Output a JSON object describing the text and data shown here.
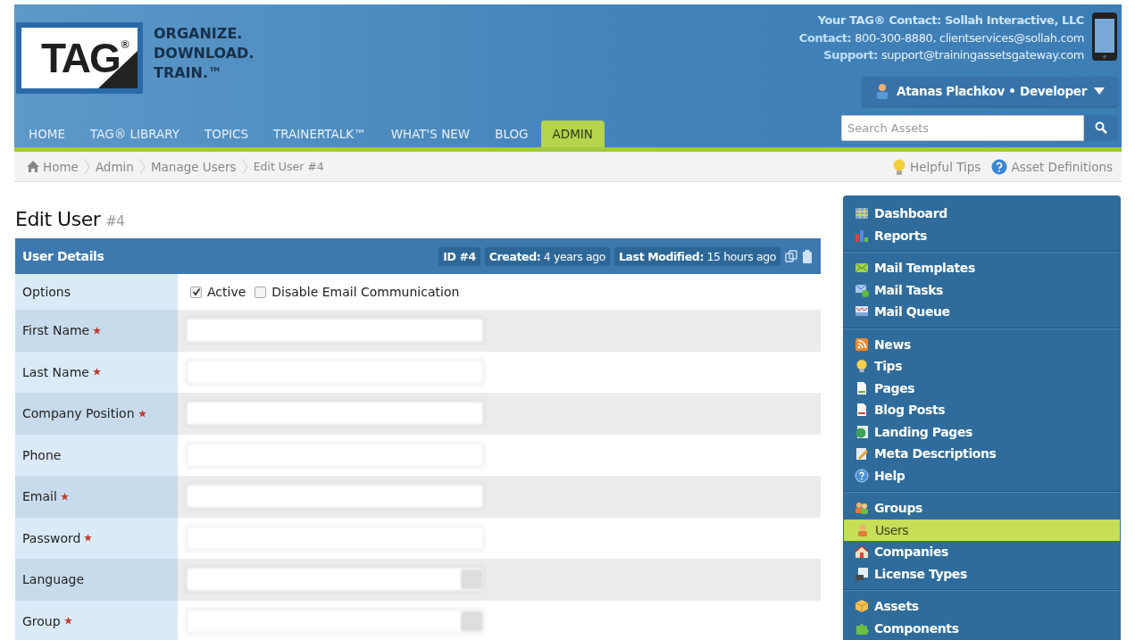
{
  "header": {
    "logo": "TAG",
    "logo_mark": "®",
    "tagline": [
      "ORGANIZE.",
      "DOWNLOAD.",
      "TRAIN.™"
    ],
    "contact_lines": [
      "Your TAG® Contact: Sollah Interactive, LLC",
      "**Contact:** 800-300-8880, clientservices@sollah.com",
      "**Support:** support@trainingassetsgateway.com"
    ],
    "user_menu": {
      "label": "Atanas Plachkov • Developer"
    },
    "search": {
      "placeholder": "Search Assets"
    }
  },
  "nav": [
    {
      "label": "HOME",
      "selected": false
    },
    {
      "label": "TAG® LIBRARY",
      "selected": false
    },
    {
      "label": "TOPICS",
      "selected": false
    },
    {
      "label": "TRAINERTALK™",
      "selected": false
    },
    {
      "label": "WHAT'S NEW",
      "selected": false
    },
    {
      "label": "BLOG",
      "selected": false
    },
    {
      "label": "ADMIN",
      "selected": true
    }
  ],
  "breadcrumbs": [
    "Home",
    "Admin",
    "Manage Users",
    "Edit User #4"
  ],
  "help_links": [
    {
      "kind": "tips",
      "label": "Helpful Tips"
    },
    {
      "kind": "definitions",
      "label": "Asset Definitions"
    }
  ],
  "page_title": {
    "text": "Edit User",
    "suffix": "#4"
  },
  "panel": {
    "title": "User Details",
    "badges": [
      "ID #4",
      "**Created:** 4 years ago",
      "**Last Modified:** 15 hours ago"
    ],
    "options": {
      "label": "Options",
      "checks": [
        {
          "label": "Active",
          "checked": true
        },
        {
          "label": "Disable Email Communication",
          "checked": false
        }
      ]
    },
    "fields": [
      {
        "label": "First Name",
        "required": true,
        "kind": "text"
      },
      {
        "label": "Last Name",
        "required": true,
        "kind": "text"
      },
      {
        "label": "Company Position",
        "required": true,
        "kind": "text"
      },
      {
        "label": "Phone",
        "required": false,
        "kind": "text"
      },
      {
        "label": "Email",
        "required": true,
        "kind": "text"
      },
      {
        "label": "Password",
        "required": true,
        "kind": "text"
      },
      {
        "label": "Language",
        "required": false,
        "kind": "select"
      },
      {
        "label": "Group",
        "required": true,
        "kind": "select"
      }
    ]
  },
  "sidebar": {
    "groups": [
      [
        {
          "kind": "dashboard",
          "label": "Dashboard",
          "selected": false
        },
        {
          "kind": "reports",
          "label": "Reports",
          "selected": false
        }
      ],
      [
        {
          "kind": "mail",
          "label": "Mail Templates",
          "selected": false
        },
        {
          "kind": "mailtask",
          "label": "Mail Tasks",
          "selected": false
        },
        {
          "kind": "mailqueue",
          "label": "Mail Queue",
          "selected": false
        }
      ],
      [
        {
          "kind": "rss",
          "label": "News",
          "selected": false
        },
        {
          "kind": "bulb",
          "label": "Tips",
          "selected": false
        },
        {
          "kind": "page",
          "label": "Pages",
          "selected": false
        },
        {
          "kind": "post",
          "label": "Blog Posts",
          "selected": false
        },
        {
          "kind": "globe",
          "label": "Landing Pages",
          "selected": false
        },
        {
          "kind": "pencil",
          "label": "Meta Descriptions",
          "selected": false
        },
        {
          "kind": "help",
          "label": "Help",
          "selected": false
        }
      ],
      [
        {
          "kind": "group",
          "label": "Groups",
          "selected": false
        },
        {
          "kind": "user",
          "label": "Users",
          "selected": true
        },
        {
          "kind": "house",
          "label": "Companies",
          "selected": false
        },
        {
          "kind": "license",
          "label": "License Types",
          "selected": false
        }
      ],
      [
        {
          "kind": "box",
          "label": "Assets",
          "selected": false
        },
        {
          "kind": "puzzle",
          "label": "Components",
          "selected": false
        }
      ]
    ]
  }
}
